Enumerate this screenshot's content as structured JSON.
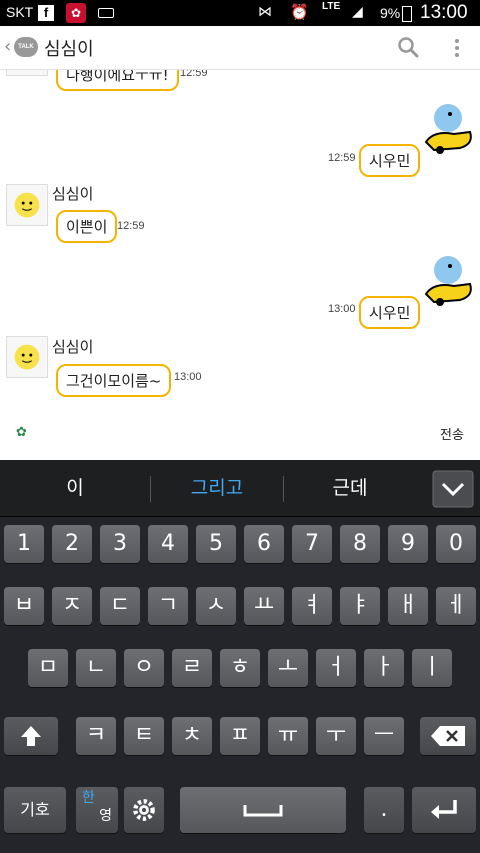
{
  "status_bar": {
    "carrier": "SKT",
    "battery_text": "9%",
    "network": "LTE",
    "time": "13:00"
  },
  "header": {
    "logo_text": "TALK",
    "title": "심심이"
  },
  "messages": [
    {
      "side": "left",
      "text": "다행이에요ㅜㅠ!",
      "time": "12:59"
    },
    {
      "side": "right",
      "text": "시우민",
      "time": "12:59"
    },
    {
      "side": "left",
      "sender": "심심이",
      "text": "이쁜이",
      "time": "12:59"
    },
    {
      "side": "right",
      "text": "시우민",
      "time": "13:00"
    },
    {
      "side": "left",
      "sender": "심심이",
      "text": "그건이모이름~",
      "time": "13:00"
    }
  ],
  "input_bar": {
    "send_label": "전송"
  },
  "suggestions": [
    "이",
    "그리고",
    "근데"
  ],
  "keyboard": {
    "row1": [
      "1",
      "2",
      "3",
      "4",
      "5",
      "6",
      "7",
      "8",
      "9",
      "0"
    ],
    "row2": [
      "ㅂ",
      "ㅈ",
      "ㄷ",
      "ㄱ",
      "ㅅ",
      "ㅛ",
      "ㅕ",
      "ㅑ",
      "ㅐ",
      "ㅔ"
    ],
    "row3": [
      "ㅁ",
      "ㄴ",
      "ㅇ",
      "ㄹ",
      "ㅎ",
      "ㅗ",
      "ㅓ",
      "ㅏ",
      "ㅣ"
    ],
    "row4": [
      "ㅋ",
      "ㅌ",
      "ㅊ",
      "ㅍ",
      "ㅠ",
      "ㅜ",
      "ㅡ"
    ],
    "symbols_label": "기호",
    "lang_top": "한",
    "lang_bottom": "영",
    "period_label": "."
  },
  "colors": {
    "bubble_border": "#f4b400",
    "suggestion_active": "#3fa9f5"
  }
}
